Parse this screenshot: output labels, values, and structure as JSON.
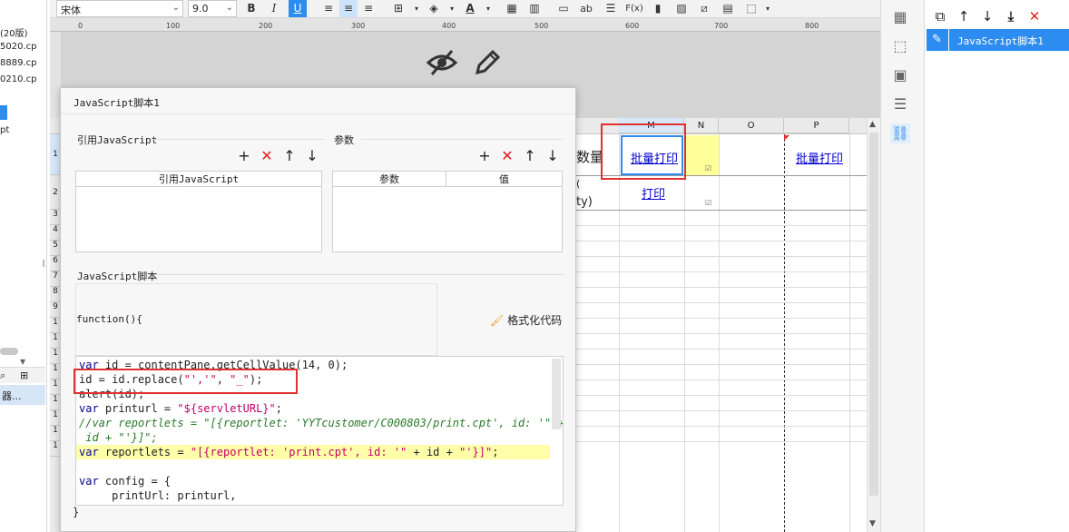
{
  "left_panel": {
    "items": [
      "(20版)",
      "5020.cp",
      "8889.cp",
      "0210.cp",
      "pt",
      "器..."
    ]
  },
  "toolbar": {
    "font_name": "宋体",
    "font_size": "9.0",
    "bold": "B",
    "italic": "I",
    "underline": "U",
    "ab": "ab",
    "fx": "F(x)"
  },
  "ruler": {
    "ticks": [
      "0",
      "100",
      "200",
      "300",
      "400",
      "500",
      "600",
      "700",
      "800"
    ]
  },
  "sheet": {
    "columns": [
      "M",
      "N",
      "O",
      "P"
    ],
    "row_numbers": [
      "1",
      "2",
      "3",
      "4",
      "5",
      "6",
      "7",
      "8",
      "9",
      "1",
      "1",
      "1",
      "1",
      "1",
      "1",
      "1",
      "1",
      "1"
    ],
    "cell_qty_header": "数量",
    "cell_qty_sub": "(",
    "cell_qty_sub2": "ty)",
    "cell_batch_print": "批量打印",
    "cell_print": "打印",
    "cell_batch_print_p": "批量打印"
  },
  "right_panel": {
    "item_label": "JavaScript脚本1"
  },
  "dialog": {
    "title": "JavaScript脚本1",
    "ref_js_section": "引用JavaScript",
    "ref_js_column": "引用JavaScript",
    "params_section": "参数",
    "params_col_param": "参数",
    "params_col_value": "值",
    "script_section": "JavaScript脚本",
    "function_header": "function(){",
    "format_code": "格式化代码",
    "closing_brace": "}"
  },
  "code_lines": [
    {
      "text": "var id = contentPane.getCellValue(14, 0);"
    },
    {
      "text": "id = id.replace(\"','\", \"_\");"
    },
    {
      "text": "alert(id);"
    },
    {
      "text": "var printurl = \"${servletURL}\";"
    },
    {
      "text": "//var reportlets = \"[{reportlet: 'YYTcustomer/C000803/print.cpt', id: '\" +"
    },
    {
      "text": " id + \"'}]\";"
    },
    {
      "text": "var reportlets = \"[{reportlet: 'print.cpt', id: '\" + id + \"'}]\";"
    },
    {
      "text": ""
    },
    {
      "text": "var config = {"
    },
    {
      "text": "     printUrl: printurl,"
    }
  ],
  "colors": {
    "accent": "#2d8cf0",
    "highlight_box": "#e03030",
    "code_highlight": "#ffffaa"
  }
}
